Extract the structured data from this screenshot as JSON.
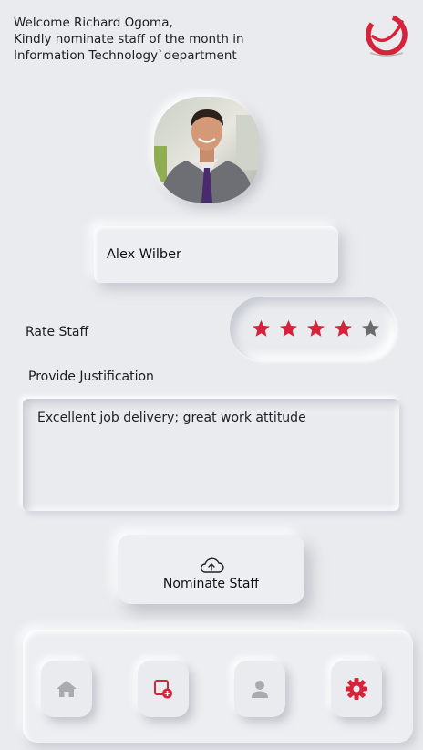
{
  "header": {
    "welcome_line1": "Welcome Richard Ogoma,",
    "welcome_line2": "Kindly nominate staff of the month in",
    "welcome_line3": "Information Technology`department"
  },
  "staff": {
    "name": "Alex Wilber"
  },
  "rating": {
    "label": "Rate Staff",
    "value": 4,
    "max": 5
  },
  "justification": {
    "label": "Provide Justification",
    "text": "Excellent job delivery; great work attitude"
  },
  "nominate": {
    "label": "Nominate Staff",
    "icon": "cloud-upload-icon"
  },
  "nav": {
    "items": [
      {
        "icon": "home-icon"
      },
      {
        "icon": "add-document-icon"
      },
      {
        "icon": "user-icon"
      },
      {
        "icon": "gear-icon"
      }
    ]
  },
  "colors": {
    "accent": "#d6223a",
    "inactive_star": "#6b6b6b",
    "background": "#e9ebee",
    "nav_icon_gray": "#a9abaf"
  }
}
